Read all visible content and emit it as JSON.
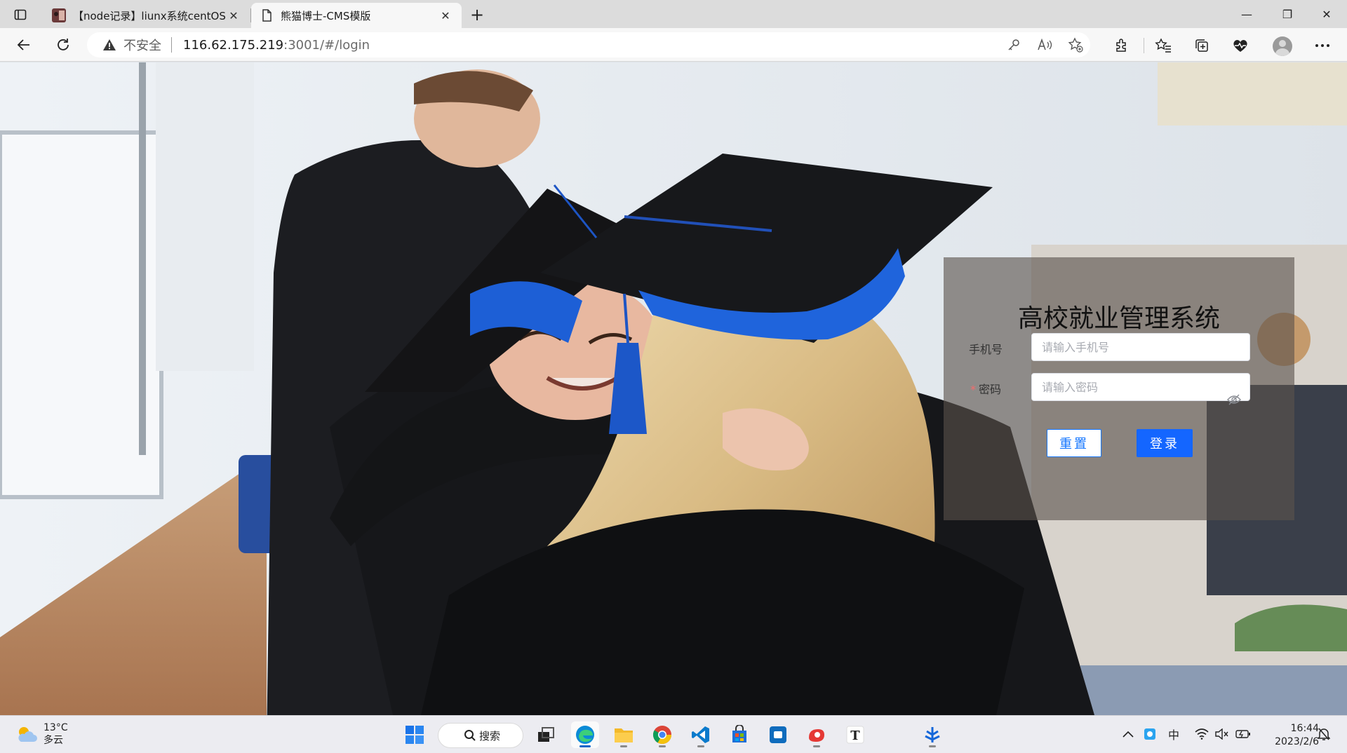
{
  "browser": {
    "tabs": [
      {
        "title": "【node记录】liunx系统centOS安",
        "active": false,
        "close": "✕"
      },
      {
        "title": "熊猫博士-CMS模版",
        "active": true,
        "close": "✕"
      }
    ],
    "new_tab": "+",
    "window_controls": {
      "minimize": "—",
      "maximize": "❐",
      "close": "✕"
    },
    "address": {
      "security_text": "不安全",
      "host": "116.62.175.219",
      "path": ":3001/#/login"
    }
  },
  "login": {
    "title": "高校就业管理系统",
    "phone_label": "手机号",
    "phone_placeholder": "请输入手机号",
    "password_label": "密码",
    "password_placeholder": "请输入密码",
    "required_mark": "*",
    "reset_label": "重置",
    "login_label": "登录"
  },
  "colors": {
    "primary": "#1466ff",
    "panel_overlay": "#5a524c",
    "required": "#f56c6c"
  },
  "taskbar": {
    "weather": {
      "temp": "13°C",
      "condition": "多云"
    },
    "search_label": "搜索",
    "apps": [
      "start",
      "search",
      "task-view",
      "edge",
      "file-explorer",
      "chrome",
      "vscode",
      "store",
      "todo",
      "snipaste",
      "typora",
      "feishu"
    ],
    "tray": {
      "ime": "中"
    },
    "clock": {
      "time": "16:44",
      "date": "2023/2/6"
    }
  }
}
